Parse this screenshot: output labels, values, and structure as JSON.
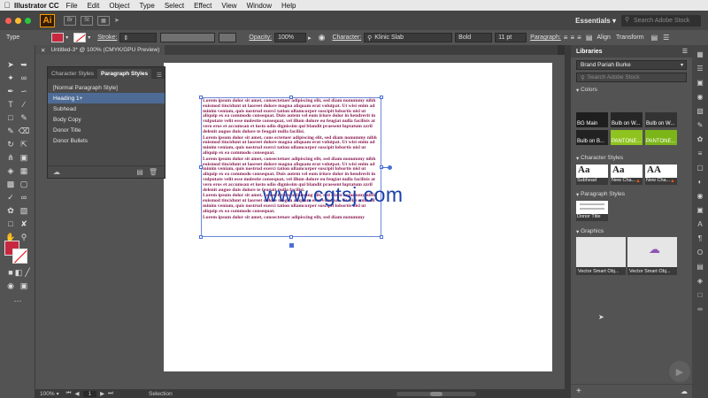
{
  "menubar": {
    "app_name": "Illustrator CC",
    "items": [
      "File",
      "Edit",
      "Object",
      "Type",
      "Select",
      "Effect",
      "View",
      "Window",
      "Help"
    ]
  },
  "appbar": {
    "logo": "Ai",
    "icons": [
      "Br",
      "St"
    ],
    "workspace": "Essentials",
    "stock_search_placeholder": "Search Adobe Stock"
  },
  "control": {
    "object_type": "Type",
    "stroke_label": "Stroke:",
    "opacity_label": "Opacity:",
    "opacity_value": "100%",
    "character_label": "Character:",
    "font_family": "Klinic Slab",
    "font_style": "Bold",
    "font_size": "11 pt",
    "paragraph_label": "Paragraph:",
    "align_label": "Align",
    "transform_label": "Transform"
  },
  "document": {
    "tab_title": "Untitled-3* @ 100% (CMYK/GPU Preview)",
    "paragraphs": [
      "Lorem ipsum dolor sit amet, consectetuer adipiscing elit, sed diam nonummy nibh euismod tincidunt ut laoreet dolore magna aliquam erat volutpat. Ut wisi enim ad minim veniam, quis nostrud exerci tation ullamcorper suscipit lobortis nisl ut aliquip ex ea commodo consequat. Duis autem vel eum iriure dolor in hendrerit in vulputate velit esse molestie consequat, vel illum dolore eu feugiat nulla facilisis at vero eros et accumsan et iusto odio dignissim qui blandit praesent luptatum zzril delenit augue duis dolore te feugait nulla facilisi.",
      "Lorem ipsum dolor sit amet, cons ectetuer adipiscing elit, sed diam nonummy nibh euismod tincidunt ut laoreet dolore magna aliquam erat volutpat. Ut wisi enim ad minim veniam, quis nostrud exerci tation ullamcorper suscipit lobortis nisl ut aliquip ex ea commodo consequat.",
      "Lorem ipsum dolor sit amet, consectetuer adipiscing elit, sed diam nonummy nibh euismod tincidunt ut laoreet dolore magna aliquam erat volutpat. Ut wisi enim ad minim veniam, quis nostrud exerci tation ullamcorper suscipit lobortis nisl ut aliquip ex ea commodo consequat. Duis autem vel eum iriure dolor in hendrerit in vulputate velit esse molestie consequat, vel illum dolore eu feugiat nulla facilisis at vero eros et accumsan et iusto odio dignissim qui blandit praesent luptatum zzril delenit augue duis dolore te feugait nulla facilisi.",
      "Lorem ipsum dolor sit amet, consectetuer adipiscing elit, sed diam nonummy nibh euismod tincidunt ut laoreet dolore magna aliquam erat volutpat. Ut wisi enim ad minim veniam, quis nostrud exerci tation ullamcorper suscipit lobortis nisl ut aliquip ex ea commodo consequat.",
      "Lorem ipsum dolor sit amet, consectetuer adipiscing elit, sed diam nonummy"
    ],
    "watermark": "www.cgtsj.com"
  },
  "status": {
    "zoom": "100%",
    "artboard_number": "1",
    "tool": "Selection"
  },
  "styles_panel": {
    "tabs": [
      "Character Styles",
      "Paragraph Styles"
    ],
    "items": [
      "[Normal Paragraph Style]",
      "Heading 1+",
      "Subhead",
      "Body Copy",
      "Donor Title",
      "Donor Bullets"
    ],
    "selected_index": 1
  },
  "libraries": {
    "title": "Libraries",
    "library_name": "Brand Pariah Burke",
    "search_placeholder": "Search Adobe Stock",
    "sections": {
      "colors": "Colors",
      "character_styles": "Character Styles",
      "paragraph_styles": "Paragraph Styles",
      "graphics": "Graphics"
    },
    "colors": [
      {
        "label": "BG Main",
        "hex": "#1e1e1e"
      },
      {
        "label": "Bulb on W...",
        "hex": "#262626"
      },
      {
        "label": "Bulb on W...",
        "hex": "#333333"
      },
      {
        "label": "Bulb on B...",
        "hex": "#222222"
      },
      {
        "label": "PANTONE...",
        "hex": "#8fc31f"
      },
      {
        "label": "PANTONE...",
        "hex": "#7cb518"
      }
    ],
    "character_styles": [
      {
        "sample": "Aa",
        "label": "Subhead"
      },
      {
        "sample": "Aa",
        "label": "New Cha..."
      },
      {
        "sample": "AA",
        "label": "New Cha..."
      }
    ],
    "paragraph_styles": [
      {
        "label": "Donor Title"
      }
    ],
    "graphics": [
      {
        "label": "Vector Smart Obj..."
      },
      {
        "label": "Vector Smart Obj..."
      }
    ]
  }
}
